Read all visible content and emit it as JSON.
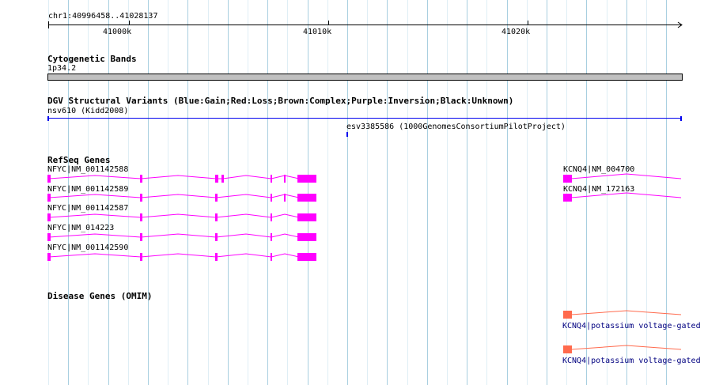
{
  "colors": {
    "grid_major": "#a8cfe0",
    "grid_minor": "#dfeef5",
    "axis": "#000000",
    "cyto_band": "#c0c0c0",
    "dgv_blue": "#0000ee",
    "refseq": "#ff00ff",
    "omim": "#ff6a4d",
    "omim_label": "#000080"
  },
  "ruler": {
    "range_label": "chr1:40996458..41028137",
    "ticks": [
      {
        "label": "41000k",
        "pos": 41000000
      },
      {
        "label": "41010k",
        "pos": 41010000
      },
      {
        "label": "41020k",
        "pos": 41020000
      }
    ]
  },
  "cyto": {
    "title": "Cytogenetic Bands",
    "band_label": "1p34.2"
  },
  "dgv": {
    "title": "DGV Structural Variants (Blue:Gain;Red:Loss;Brown:Complex;Purple:Inversion;Black:Unknown)",
    "features": [
      {
        "label": "nsv610 (Kidd2008)"
      },
      {
        "label": "esv3385586 (1000GenomesConsortiumPilotProject)"
      }
    ]
  },
  "refseq": {
    "title": "RefSeq Genes",
    "transcripts": [
      {
        "label": "NFYC|NM_001142588"
      },
      {
        "label": "NFYC|NM_001142589"
      },
      {
        "label": "NFYC|NM_001142587"
      },
      {
        "label": "NFYC|NM_014223"
      },
      {
        "label": "NFYC|NM_001142590"
      },
      {
        "label": "KCNQ4|NM_004700"
      },
      {
        "label": "KCNQ4|NM_172163"
      }
    ]
  },
  "omim": {
    "title": "Disease Genes (OMIM)",
    "genes": [
      {
        "label": "KCNQ4|potassium voltage-gated"
      },
      {
        "label": "KCNQ4|potassium voltage-gated"
      }
    ]
  }
}
